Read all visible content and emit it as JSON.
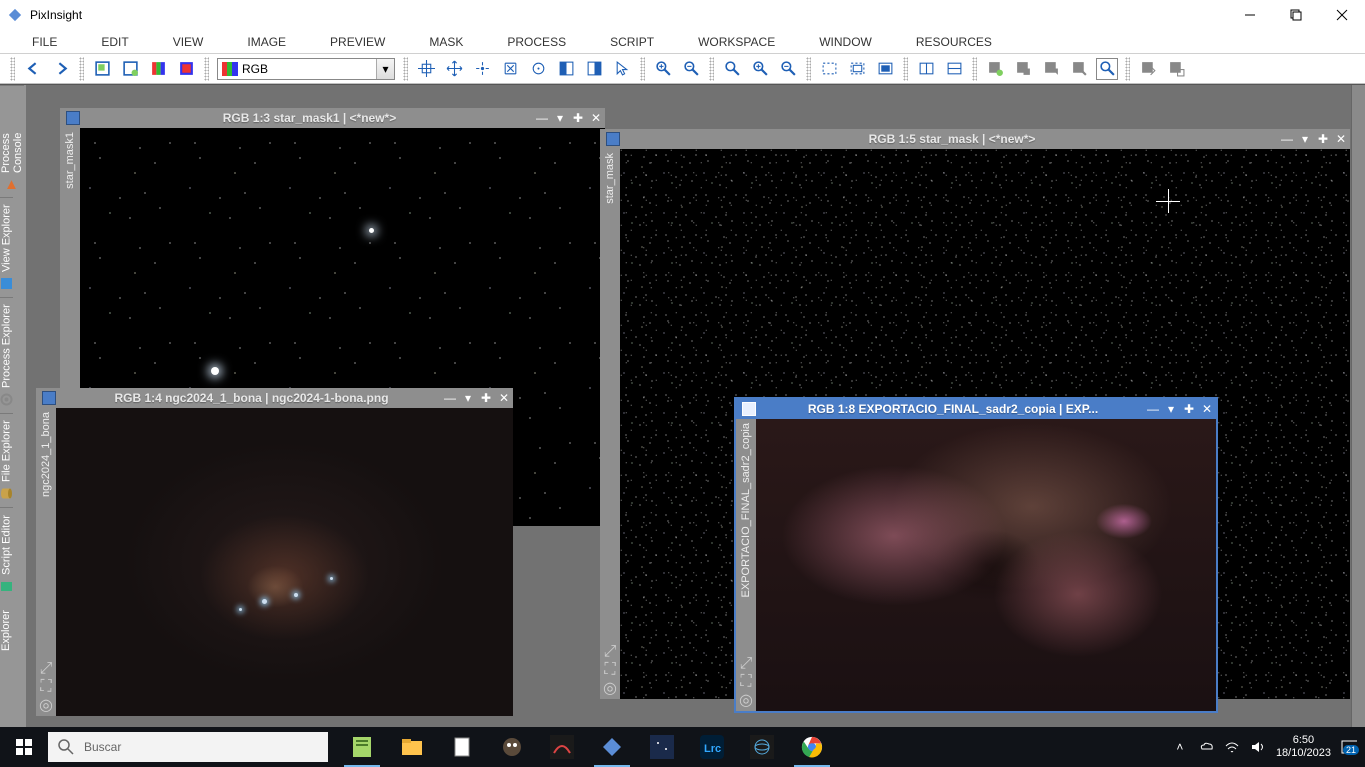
{
  "app": {
    "title": "PixInsight"
  },
  "menu": [
    "FILE",
    "EDIT",
    "VIEW",
    "IMAGE",
    "PREVIEW",
    "MASK",
    "PROCESS",
    "SCRIPT",
    "WORKSPACE",
    "WINDOW",
    "RESOURCES"
  ],
  "channel_selector": {
    "value": "RGB"
  },
  "side_tabs": [
    {
      "label": "Process Console",
      "icon": "triangle",
      "color": "#e07030"
    },
    {
      "label": "View Explorer",
      "icon": "square",
      "color": "#3a8dd8"
    },
    {
      "label": "Process Explorer",
      "icon": "gear",
      "color": "#888"
    },
    {
      "label": "File Explorer",
      "icon": "cylinder",
      "color": "#c9a24a"
    },
    {
      "label": "Script Editor",
      "icon": "doc",
      "color": "#36b37e"
    },
    {
      "label": "Explorer",
      "icon": "",
      "color": ""
    }
  ],
  "windows": {
    "w1": {
      "title": "RGB 1:3 star_mask1 | <*new*>",
      "side": "star_mask1"
    },
    "w2": {
      "title": "RGB 1:5 star_mask | <*new*>",
      "side": "star_mask"
    },
    "w3": {
      "title": "RGB 1:4 ngc2024_1_bona | ngc2024-1-bona.png",
      "side": "ngc2024_1_bona"
    },
    "w4": {
      "title": "RGB 1:8 EXPORTACIO_FINAL_sadr2_copia | EXP...",
      "side": "EXPORTACIO_FINAL_sadr2_copia"
    }
  },
  "taskbar": {
    "search_placeholder": "Buscar",
    "time": "6:50",
    "date": "18/10/2023",
    "notif_count": "21"
  }
}
